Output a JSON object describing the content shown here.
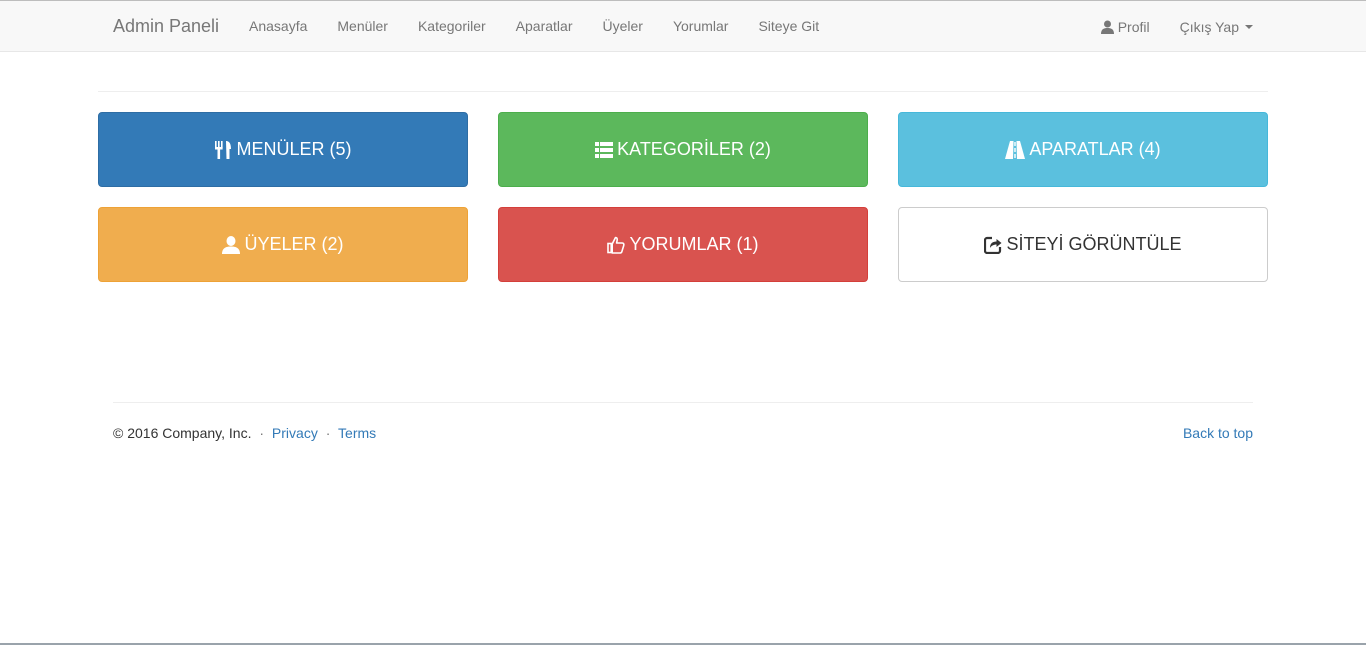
{
  "navbar": {
    "brand": "Admin Paneli",
    "links": [
      "Anasayfa",
      "Menüler",
      "Kategoriler",
      "Aparatlar",
      "Üyeler",
      "Yorumlar",
      "Siteye Git"
    ],
    "profile_label": "Profil",
    "logout_label": "Çıkış Yap"
  },
  "tiles": {
    "menus": {
      "label": "MENÜLER (5)",
      "icon": "cutlery-icon",
      "color": "#337ab7"
    },
    "categories": {
      "label": "KATEGORİLER (2)",
      "icon": "list-icon",
      "color": "#5cb85c"
    },
    "apparatus": {
      "label": "APARATLAR (4)",
      "icon": "road-icon",
      "color": "#5bc0de"
    },
    "members": {
      "label": "ÜYELER (2)",
      "icon": "user-icon",
      "color": "#f0ad4e"
    },
    "comments": {
      "label": "YORUMLAR (1)",
      "icon": "thumbs-up-icon",
      "color": "#d9534f"
    },
    "view_site": {
      "label": "SİTEYİ GÖRÜNTÜLE",
      "icon": "share-icon",
      "color": "#ffffff"
    }
  },
  "footer": {
    "copyright": "© 2016 Company, Inc.",
    "separator": "·",
    "privacy": "Privacy",
    "terms": "Terms",
    "back_to_top": "Back to top"
  }
}
